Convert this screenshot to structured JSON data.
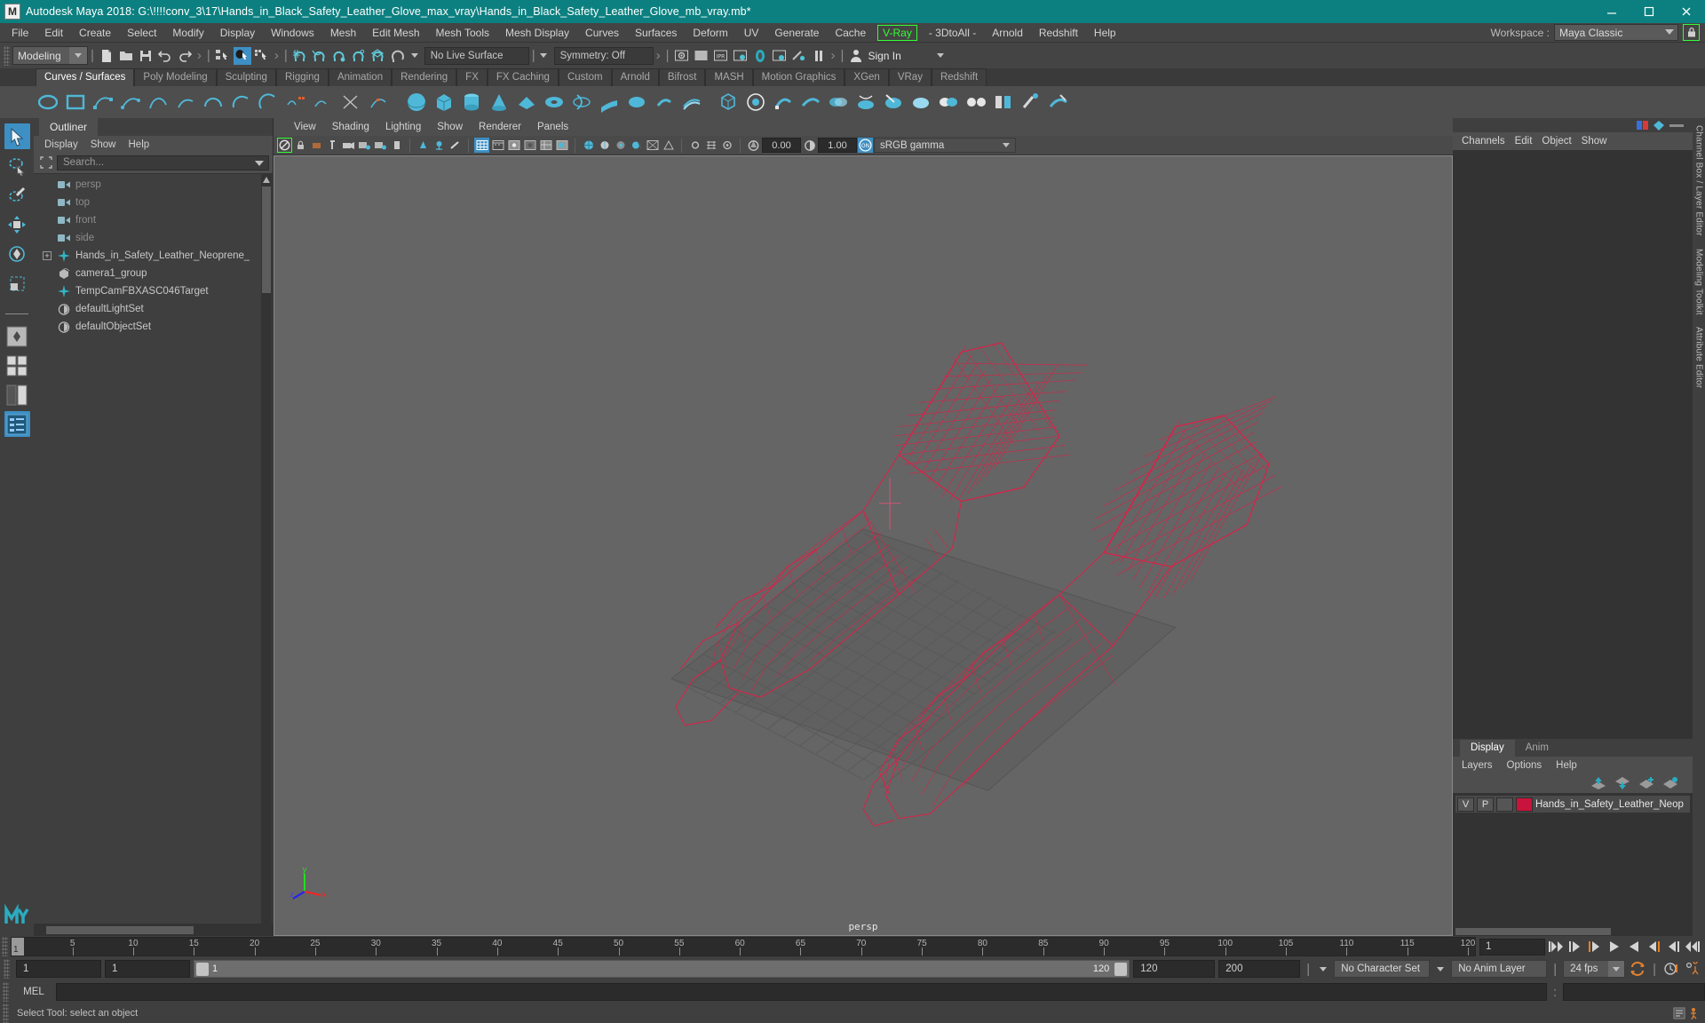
{
  "titlebar": {
    "app_icon": "maya-logo-icon",
    "title": "Autodesk Maya 2018: G:\\!!!!conv_3\\17\\Hands_in_Black_Safety_Leather_Glove_max_vray\\Hands_in_Black_Safety_Leather_Glove_mb_vray.mb*",
    "minimize": "–",
    "maximize": "□",
    "close": "✕",
    "bg_color": "#0c8080"
  },
  "menubar": {
    "items": [
      "File",
      "Edit",
      "Create",
      "Select",
      "Modify",
      "Display",
      "Windows",
      "Mesh",
      "Edit Mesh",
      "Mesh Tools",
      "Mesh Display",
      "Curves",
      "Surfaces",
      "Deform",
      "UV",
      "Generate",
      "Cache"
    ],
    "highlight_item": "V-Ray",
    "items_after": [
      "- 3DtoAll -",
      "Arnold",
      "Redshift",
      "Help"
    ],
    "highlight_color": "#33ff33",
    "workspace_label": "Workspace :",
    "workspace_value": "Maya Classic",
    "lock_icon": "lock-icon"
  },
  "statusline": {
    "mode": "Modeling",
    "live_surface": "No Live Surface",
    "symmetry": "Symmetry: Off",
    "signin": "Sign In"
  },
  "shelf": {
    "tabs": [
      {
        "label": "Curves / Surfaces",
        "active": true
      },
      {
        "label": "Poly Modeling",
        "active": false
      },
      {
        "label": "Sculpting",
        "active": false
      },
      {
        "label": "Rigging",
        "active": false
      },
      {
        "label": "Animation",
        "active": false
      },
      {
        "label": "Rendering",
        "active": false
      },
      {
        "label": "FX",
        "active": false
      },
      {
        "label": "FX Caching",
        "active": false
      },
      {
        "label": "Custom",
        "active": false
      },
      {
        "label": "Arnold",
        "active": false
      },
      {
        "label": "Bifrost",
        "active": false
      },
      {
        "label": "MASH",
        "active": false
      },
      {
        "label": "Motion Graphics",
        "active": false
      },
      {
        "label": "XGen",
        "active": false
      },
      {
        "label": "VRay",
        "active": false
      },
      {
        "label": "Redshift",
        "active": false
      }
    ]
  },
  "outliner": {
    "tab_label": "Outliner",
    "menu": [
      "Display",
      "Show",
      "Help"
    ],
    "search_placeholder": "Search...",
    "items": [
      {
        "label": "persp",
        "icon": "camera-icon",
        "dim": true,
        "expandable": false
      },
      {
        "label": "top",
        "icon": "camera-icon",
        "dim": true,
        "expandable": false
      },
      {
        "label": "front",
        "icon": "camera-icon",
        "dim": true,
        "expandable": false
      },
      {
        "label": "side",
        "icon": "camera-icon",
        "dim": true,
        "expandable": false
      },
      {
        "label": "Hands_in_Safety_Leather_Neoprene_",
        "icon": "transform-icon",
        "dim": false,
        "expandable": true
      },
      {
        "label": "camera1_group",
        "icon": "group-icon",
        "dim": false,
        "expandable": false
      },
      {
        "label": "TempCamFBXASC046Target",
        "icon": "transform-icon",
        "dim": false,
        "expandable": false
      },
      {
        "label": "defaultLightSet",
        "icon": "set-icon",
        "dim": false,
        "expandable": false
      },
      {
        "label": "defaultObjectSet",
        "icon": "set-icon",
        "dim": false,
        "expandable": false
      }
    ]
  },
  "viewport": {
    "menu": [
      "View",
      "Shading",
      "Lighting",
      "Show",
      "Renderer",
      "Panels"
    ],
    "exposure_value": "0.00",
    "gamma_value": "1.00",
    "color_management": "sRGB gamma",
    "camera_label": "persp",
    "axis": {
      "x": "x",
      "y": "y",
      "z": "z",
      "x_color": "#ff2020",
      "y_color": "#20e020",
      "z_color": "#2020ff"
    },
    "model_wireframe_color": "#e01f46",
    "background_color": "#656565"
  },
  "channelbox": {
    "menu": [
      "Channels",
      "Edit",
      "Object",
      "Show"
    ],
    "side_tabs": [
      "Channel Box / Layer Editor",
      "Modeling Toolkit",
      "Attribute Editor"
    ]
  },
  "layereditor": {
    "tabs": [
      {
        "label": "Display",
        "active": true
      },
      {
        "label": "Anim",
        "active": false
      }
    ],
    "menu": [
      "Layers",
      "Options",
      "Help"
    ],
    "layers": [
      {
        "visible": "V",
        "playback": "P",
        "state": "",
        "color": "#c8143c",
        "name": "Hands_in_Safety_Leather_Neop"
      }
    ]
  },
  "timeline": {
    "current_frame_marker": "1",
    "ticks": [
      5,
      10,
      15,
      20,
      25,
      30,
      35,
      40,
      45,
      50,
      55,
      60,
      65,
      70,
      75,
      80,
      85,
      90,
      95,
      100,
      105,
      110,
      115,
      120
    ],
    "start": 1,
    "end": 120,
    "current_frame_field": "1",
    "range_start_field": "1",
    "range_start2_field": "1",
    "range_slider_start": "1",
    "range_slider_end": "120",
    "anim_end_field": "120",
    "playback_end_field": "200",
    "character_set": "No Character Set",
    "anim_layer": "No Anim Layer",
    "fps": "24 fps"
  },
  "commandline": {
    "label": "MEL",
    "value": "",
    "help_text": "Select Tool: select an object"
  }
}
